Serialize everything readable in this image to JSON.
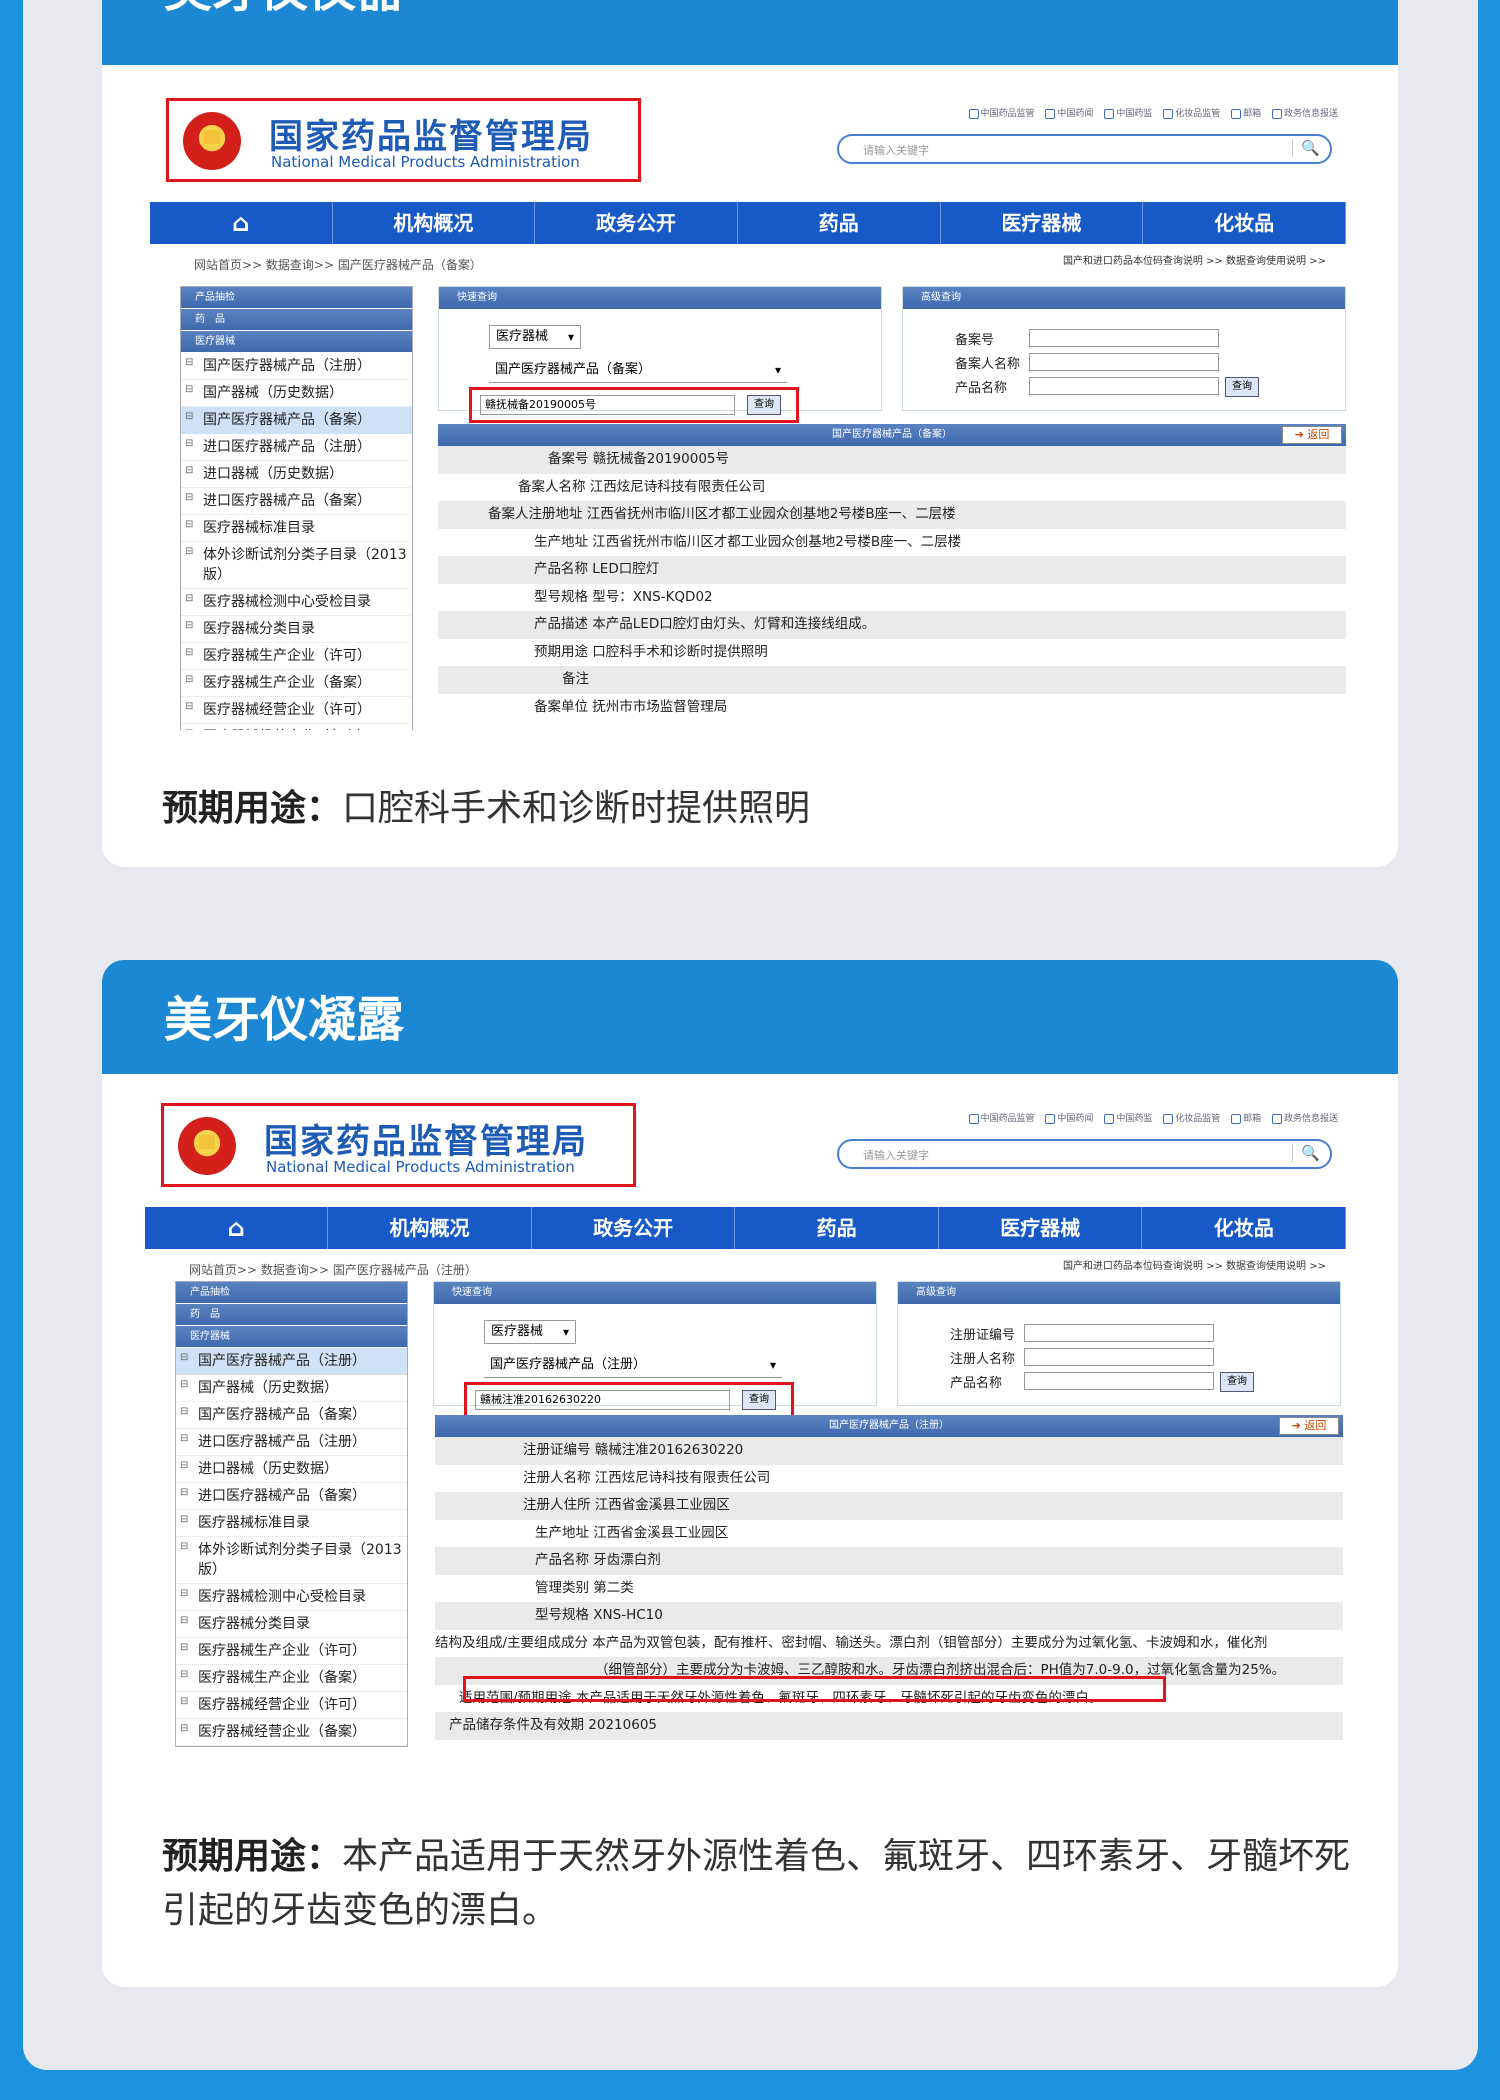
{
  "card1": {
    "title": "美牙仪仪器",
    "caption_label": "预期用途：",
    "caption_text": "口腔科手术和诊断时提供照明",
    "breadcrumb": "网站首页>> 数据查询>> 国产医疗器械产品（备案）",
    "query_value": "赣抚械备20190005号",
    "product_select": "国产医疗器械产品（备案）",
    "adv_fields": [
      "备案号",
      "备案人名称",
      "产品名称"
    ],
    "result_header": "国产医疗器械产品（备案）",
    "rows": [
      "备案号 赣抚械备20190005号",
      "备案人名称 江西炫尼诗科技有限责任公司",
      "备案人注册地址 江西省抚州市临川区才都工业园众创基地2号楼B座一、二层楼",
      "生产地址 江西省抚州市临川区才都工业园众创基地2号楼B座一、二层楼",
      "产品名称 LED口腔灯",
      "型号规格 型号：XNS-KQD02",
      "产品描述 本产品LED口腔灯由灯头、灯臂和连接线组成。",
      "预期用途 口腔科手术和诊断时提供照明",
      "备注",
      "备案单位 抚州市市场监督管理局"
    ]
  },
  "card2": {
    "title": "美牙仪凝露",
    "caption_label": "预期用途：",
    "caption_text": "本产品适用于天然牙外源性着色、氟斑牙、四环素牙、牙髓坏死引起的牙齿变色的漂白。",
    "breadcrumb": "网站首页>> 数据查询>> 国产医疗器械产品（注册）",
    "query_value": "赣械注准20162630220",
    "product_select": "国产医疗器械产品（注册）",
    "adv_fields": [
      "注册证编号",
      "注册人名称",
      "产品名称"
    ],
    "result_header": "国产医疗器械产品（注册）",
    "rows": [
      "注册证编号 赣械注准20162630220",
      "注册人名称 江西炫尼诗科技有限责任公司",
      "注册人住所 江西省金溪县工业园区",
      "生产地址 江西省金溪县工业园区",
      "产品名称 牙齿漂白剂",
      "管理类别 第二类",
      "型号规格 XNS-HC10",
      "结构及组成/主要组成成分 本产品为双管包装，配有推杆、密封帽、输送头。漂白剂（钼管部分）主要成分为过氧化氢、卡波姆和水，催化剂",
      "（细管部分）主要成分为卡波姆、三乙醇胺和水。牙齿漂白剂挤出混合后：PH值为7.0-9.0，过氧化氢含量为25%。",
      "适用范围/预期用途 本产品适用于天然牙外源性着色、氟斑牙、四环素牙、牙髓坏死引起的牙齿变色的漂白。",
      "产品储存条件及有效期 20210605"
    ]
  },
  "site": {
    "logo_cn": "国家药品监督管理局",
    "logo_en": "National Medical Products Administration",
    "search_placeholder": "请输入关键字",
    "toplinks": [
      "中国药品监管",
      "中国药闻",
      "中国药监",
      "化妆品监管",
      "邮箱",
      "政务信息报送"
    ],
    "nav": [
      "⌂",
      "机构概况",
      "政务公开",
      "药品",
      "医疗器械",
      "化妆品"
    ],
    "crumb_right": "国产和进口药品本位码查询说明 >>    数据查询使用说明 >>",
    "quick_label": "快速查询",
    "adv_label": "高级查询",
    "query_btn": "查询",
    "device_select": "医疗器械",
    "back_label": "➜ 返回",
    "side_heads": [
      "产品抽检",
      "药　品",
      "医疗器械"
    ],
    "side_items": [
      "国产医疗器械产品（注册）",
      "国产器械（历史数据）",
      "国产医疗器械产品（备案）",
      "进口医疗器械产品（注册）",
      "进口器械（历史数据）",
      "进口医疗器械产品（备案）",
      "医疗器械标准目录",
      "体外诊断试剂分类子目录（2013版）",
      "医疗器械检测中心受检目录",
      "医疗器械分类目录",
      "医疗器械生产企业（许可）",
      "医疗器械生产企业（备案）",
      "医疗器械经营企业（许可）",
      "医疗器械经营企业（备案）"
    ]
  }
}
